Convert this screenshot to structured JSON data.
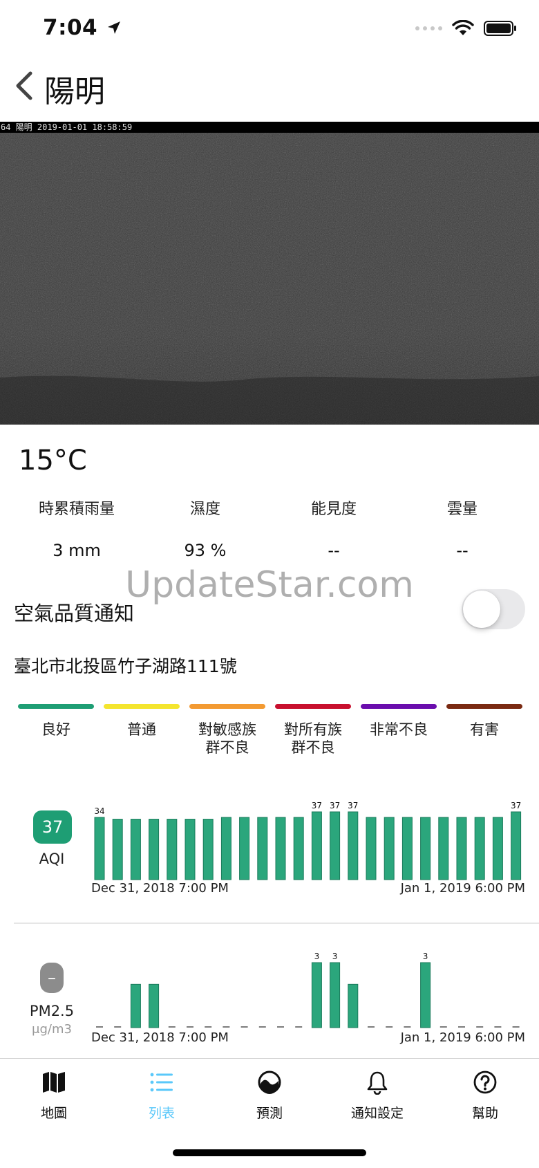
{
  "status": {
    "time": "7:04"
  },
  "nav": {
    "title": "陽明"
  },
  "camera": {
    "stamp": "64 陽明 2019-01-01 18:58:59"
  },
  "weather": {
    "temperature": "15°C",
    "columns": [
      {
        "label": "時累積雨量",
        "value": "3 mm"
      },
      {
        "label": "濕度",
        "value": "93 %"
      },
      {
        "label": "能見度",
        "value": "--"
      },
      {
        "label": "雲量",
        "value": "--"
      }
    ]
  },
  "watermark": "UpdateStar.com",
  "air_quality": {
    "label": "空氣品質通知",
    "toggle_on": false
  },
  "address": "臺北市北投區竹子湖路111號",
  "legend": [
    {
      "label": "良好",
      "color": "#1e9e74"
    },
    {
      "label": "普通",
      "color": "#f4e52e"
    },
    {
      "label": "對敏感族\n群不良",
      "color": "#f39a32"
    },
    {
      "label": "對所有族\n群不良",
      "color": "#c8102e"
    },
    {
      "label": "非常不良",
      "color": "#6a0dad"
    },
    {
      "label": "有害",
      "color": "#7a2a12"
    }
  ],
  "aqi": {
    "badge_value": "37",
    "badge_color": "#1e9e74",
    "label": "AQI",
    "x_start": "Dec 31, 2018 7:00 PM",
    "x_end": "Jan 1, 2019 6:00 PM"
  },
  "pm25": {
    "badge_value": "–",
    "badge_color": "#8c8c8c",
    "label": "PM2.5",
    "unit": "μg/m3",
    "x_start": "Dec 31, 2018 7:00 PM",
    "x_end": "Jan 1, 2019 6:00 PM"
  },
  "chart_data": [
    {
      "type": "bar",
      "name": "AQI",
      "categories": [
        "Dec 31, 2018 7:00 PM",
        "",
        "",
        "",
        "",
        "",
        "",
        "",
        "",
        "",
        "",
        "",
        "",
        "",
        "",
        "",
        "",
        "",
        "",
        "",
        "",
        "",
        "",
        "Jan 1, 2019 6:00 PM"
      ],
      "values": [
        34,
        33,
        33,
        33,
        33,
        33,
        33,
        34,
        34,
        34,
        34,
        34,
        37,
        37,
        37,
        34,
        34,
        34,
        34,
        34,
        34,
        34,
        34,
        37
      ],
      "labels": [
        "34",
        "",
        "",
        "",
        "",
        "",
        "",
        "",
        "",
        "",
        "",
        "",
        "37",
        "37",
        "37",
        "",
        "",
        "",
        "",
        "",
        "",
        "",
        "",
        "37"
      ],
      "ylim": [
        0,
        37
      ]
    },
    {
      "type": "bar",
      "name": "PM2.5",
      "categories": [
        "Dec 31, 2018 7:00 PM",
        "",
        "",
        "",
        "",
        "",
        "",
        "",
        "",
        "",
        "",
        "",
        "",
        "",
        "",
        "",
        "",
        "",
        "",
        "",
        "",
        "",
        "",
        "Jan 1, 2019 6:00 PM"
      ],
      "values": [
        0,
        0,
        2,
        2,
        0,
        0,
        0,
        0,
        0,
        0,
        0,
        0,
        3,
        3,
        2,
        0,
        0,
        0,
        3,
        0,
        0,
        0,
        0,
        0
      ],
      "labels": [
        "",
        "",
        "",
        "",
        "",
        "",
        "",
        "",
        "",
        "",
        "",
        "",
        "3",
        "3",
        "",
        "",
        "",
        "",
        "3",
        "",
        "",
        "",
        "",
        ""
      ],
      "ylim": [
        0,
        3
      ]
    }
  ],
  "tabs": [
    {
      "label": "地圖",
      "icon": "map-icon",
      "active": false
    },
    {
      "label": "列表",
      "icon": "list-icon",
      "active": true
    },
    {
      "label": "預測",
      "icon": "forecast-icon",
      "active": false
    },
    {
      "label": "通知設定",
      "icon": "bell-icon",
      "active": false
    },
    {
      "label": "幫助",
      "icon": "help-icon",
      "active": false
    }
  ]
}
